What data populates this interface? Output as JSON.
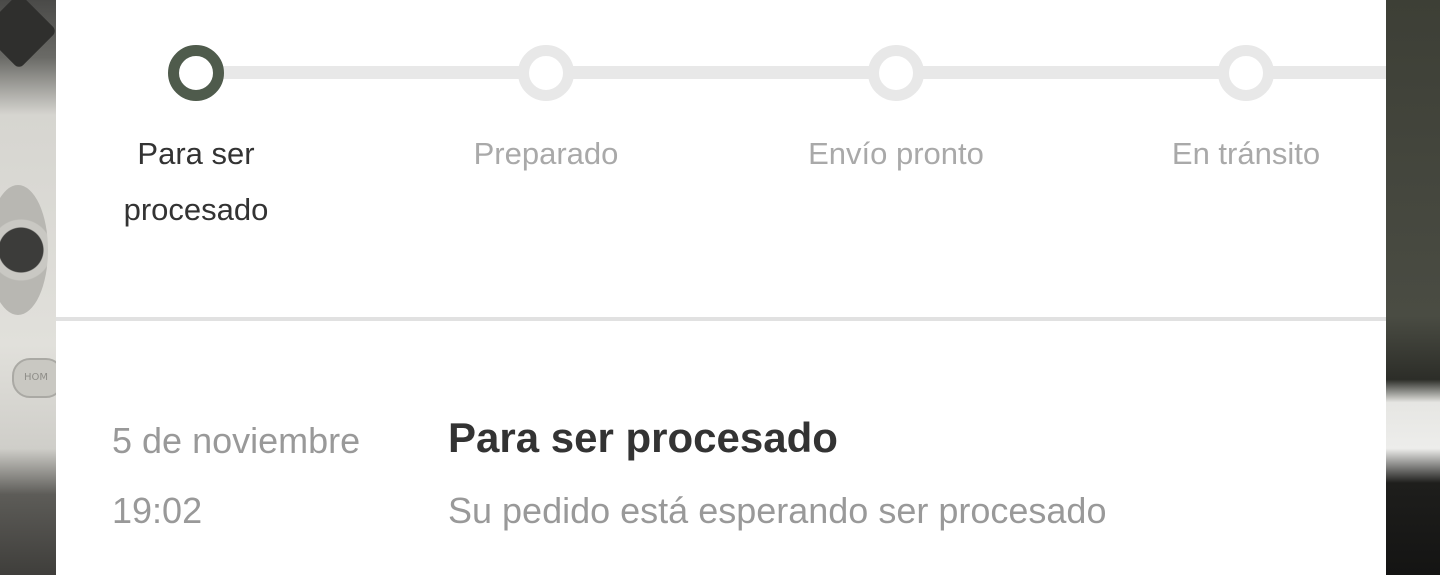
{
  "background": {
    "home_button_label": "HOM"
  },
  "tracker": {
    "active_color": "#4f5b4c",
    "inactive_color": "#e8e8e8",
    "steps": [
      {
        "label": "Para ser procesado",
        "state": "active"
      },
      {
        "label": "Preparado",
        "state": "pending"
      },
      {
        "label": "Envío pronto",
        "state": "pending"
      },
      {
        "label": "En tránsito",
        "state": "pending"
      }
    ]
  },
  "event": {
    "date": "5 de noviembre",
    "time": "19:02",
    "title": "Para ser procesado",
    "description": "Su pedido está esperando ser procesado"
  }
}
